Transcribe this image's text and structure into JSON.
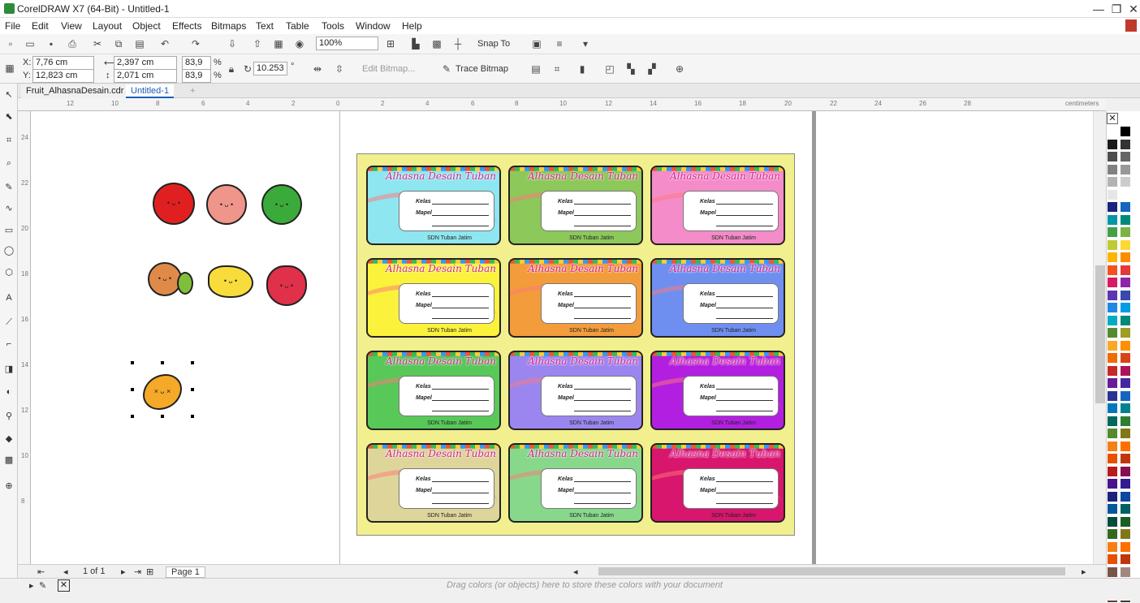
{
  "app": {
    "title": "CorelDRAW X7 (64-Bit) - Untitled-1"
  },
  "menu": [
    "File",
    "Edit",
    "View",
    "Layout",
    "Object",
    "Effects",
    "Bitmaps",
    "Text",
    "Table",
    "Tools",
    "Window",
    "Help"
  ],
  "standard": {
    "zoom": "100%",
    "snap_label": "Snap To"
  },
  "props": {
    "x": "7,76 cm",
    "y": "12,823 cm",
    "w": "2,397 cm",
    "h": "2,071 cm",
    "sx": "83,9",
    "sy": "83,9",
    "pct": "%",
    "angle": "10.253",
    "deg": "°",
    "edit_bitmap": "Edit Bitmap...",
    "trace_bitmap": "Trace Bitmap"
  },
  "tabs": [
    {
      "label": "Fruit_AlhasnaDesain.cdr"
    },
    {
      "label": "Untitled-1"
    }
  ],
  "ruler": {
    "h": [
      "12",
      "10",
      "8",
      "6",
      "4",
      "2",
      "0",
      "2",
      "4",
      "6",
      "8",
      "10",
      "12",
      "14",
      "16",
      "18",
      "20",
      "22",
      "24",
      "26",
      "28"
    ],
    "unit": "centimeters",
    "v": [
      "24",
      "22",
      "20",
      "18",
      "16",
      "14",
      "12",
      "10",
      "8"
    ]
  },
  "card": {
    "brand": "Alhasna Desain Tuban",
    "kelas": "Kelas",
    "mapel": "Mapel",
    "school": "SDN Tuban Jatim"
  },
  "card_colors": [
    "#8ee6f0",
    "#8cc85a",
    "#f38cc8",
    "#fbf23c",
    "#f39c3c",
    "#6f8ff0",
    "#58c858",
    "#9b86f0",
    "#b31fe0",
    "#ded59a",
    "#88d88c",
    "#d8166e"
  ],
  "palette": [
    "#ffffff",
    "#000000",
    "#1a1a1a",
    "#333333",
    "#4d4d4d",
    "#666666",
    "#808080",
    "#999999",
    "#b3b3b3",
    "#cccccc",
    "#e6e6e6",
    "#ffffff",
    "#1a237e",
    "#1565c0",
    "#0097a7",
    "#00897b",
    "#43a047",
    "#7cb342",
    "#c0ca33",
    "#fdd835",
    "#ffb300",
    "#fb8c00",
    "#f4511e",
    "#e53935",
    "#d81b60",
    "#8e24aa",
    "#5e35b1",
    "#3949ab",
    "#1e88e5",
    "#039be5",
    "#00acc1",
    "#00897b",
    "#558b2f",
    "#9e9d24",
    "#f9a825",
    "#ff8f00",
    "#ef6c00",
    "#d84315",
    "#c62828",
    "#ad1457",
    "#6a1b9a",
    "#4527a0",
    "#283593",
    "#1565c0",
    "#0277bd",
    "#00838f",
    "#00695c",
    "#2e7d32",
    "#558b2f",
    "#827717",
    "#f57f17",
    "#ff6f00",
    "#e65100",
    "#bf360c",
    "#b71c1c",
    "#880e4f",
    "#4a148c",
    "#311b92",
    "#1a237e",
    "#0d47a1",
    "#01579b",
    "#006064",
    "#004d40",
    "#1b5e20",
    "#33691e",
    "#827717",
    "#f57f17",
    "#ff6f00",
    "#e65100",
    "#bf360c",
    "#795548",
    "#a1887f",
    "#8d6e63",
    "#6d4c41",
    "#5d4037",
    "#4e342e"
  ],
  "nav": {
    "page_count": "1 of 1",
    "page_tab": "Page 1"
  },
  "status": {
    "hint": "Drag colors (or objects) here to store these colors with your document"
  }
}
